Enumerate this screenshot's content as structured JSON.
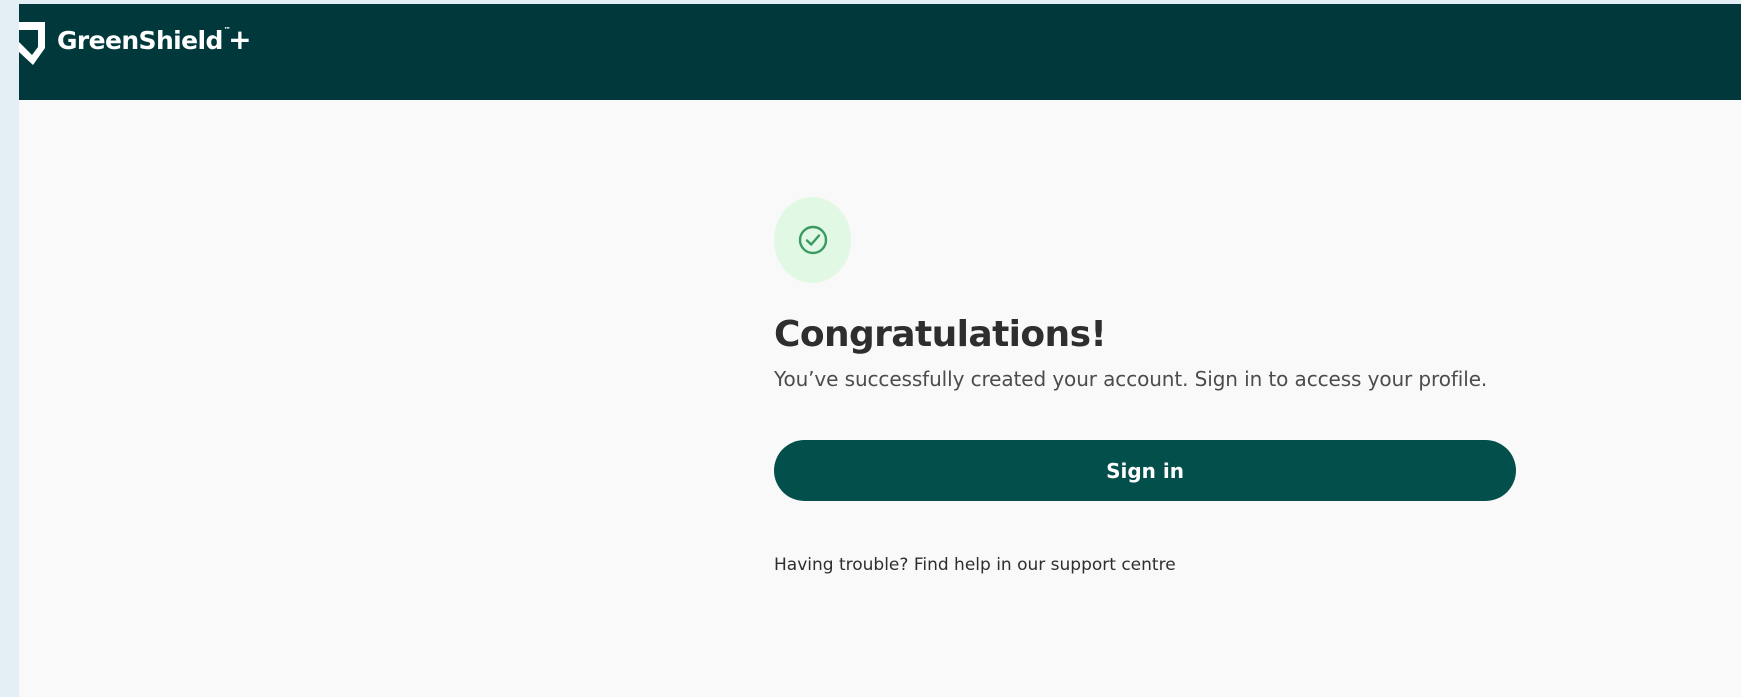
{
  "header": {
    "brand_name": "GreenShield",
    "brand_tm": "™",
    "brand_plus": "+",
    "background_color": "#01383b"
  },
  "success": {
    "icon": "check-circle-icon",
    "icon_color": "#3a9a62",
    "title": "Congratulations!",
    "message": "You’ve successfully created your account. Sign in to access your profile."
  },
  "actions": {
    "sign_in_label": "Sign in",
    "button_color": "#034f4b"
  },
  "help": {
    "prefix": "Having trouble? ",
    "link_text": "Find help in our support centre"
  }
}
